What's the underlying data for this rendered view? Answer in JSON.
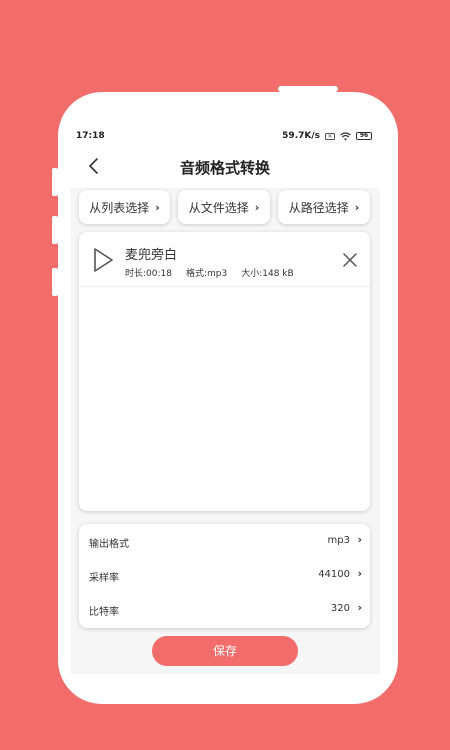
{
  "status_bar": {
    "time": "17:18",
    "speed": "59.7K/s",
    "battery": "96"
  },
  "header": {
    "title": "音频格式转换"
  },
  "sources": [
    {
      "label": "从列表选择"
    },
    {
      "label": "从文件选择"
    },
    {
      "label": "从路径选择"
    }
  ],
  "audio": {
    "name": "麦兜旁白",
    "duration": "时长:00:18",
    "format": "格式:mp3",
    "size": "大小:148 kB"
  },
  "settings": [
    {
      "label": "输出格式",
      "value": "mp3"
    },
    {
      "label": "采样率",
      "value": "44100"
    },
    {
      "label": "比特率",
      "value": "320"
    }
  ],
  "save_label": "保存",
  "colors": {
    "accent": "#f26c6c",
    "background": "#f26c6c",
    "card": "#ffffff"
  }
}
